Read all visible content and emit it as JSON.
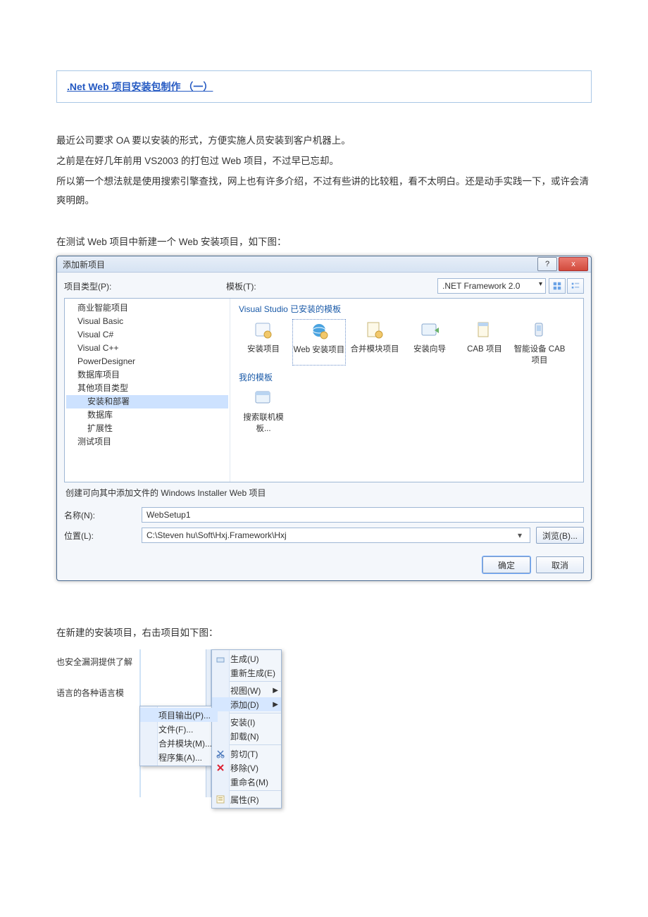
{
  "title_link": ".Net Web 项目安装包制作 （一）",
  "paragraphs": {
    "p1": "最近公司要求 OA 要以安装的形式，方便实施人员安装到客户机器上。",
    "p2": "之前是在好几年前用 VS2003 的打包过 Web 项目，不过早已忘却。",
    "p3": "所以第一个想法就是使用搜索引擎查找，网上也有许多介绍，不过有些讲的比较粗，看不太明白。还是动手实践一下，或许会清爽明朗。",
    "p4": "在测试 Web 项目中新建一个 Web 安装项目，如下图：",
    "p5": "在新建的安装项目，右击项目如下图："
  },
  "dialog": {
    "title": "添加新项目",
    "help": "?",
    "close": "x",
    "project_type_label": "项目类型(P):",
    "template_label": "模板(T):",
    "framework": ".NET Framework 2.0",
    "tree": [
      "商业智能项目",
      "Visual Basic",
      "Visual C#",
      "Visual C++",
      "PowerDesigner",
      "数据库项目",
      "其他项目类型",
      "安装和部署",
      "数据库",
      "扩展性",
      "测试项目"
    ],
    "tree_indents": [
      0,
      0,
      0,
      0,
      0,
      0,
      0,
      1,
      1,
      1,
      0
    ],
    "group_installed": "Visual Studio 已安装的模板",
    "group_my": "我的模板",
    "templates": [
      "安装项目",
      "Web 安装项目",
      "合并模块项目",
      "安装向导",
      "CAB 项目",
      "智能设备 CAB 项目"
    ],
    "search_online": "搜索联机模板...",
    "description": "创建可向其中添加文件的 Windows Installer Web 项目",
    "name_label": "名称(N):",
    "name_value": "WebSetup1",
    "location_label": "位置(L):",
    "location_value": "C:\\Steven hu\\Soft\\Hxj.Framework\\Hxj",
    "browse": "浏览(B)...",
    "ok": "确定",
    "cancel": "取消"
  },
  "ctx": {
    "left_rows": [
      "也安全漏洞提供了解",
      "语言的各种语言模"
    ],
    "left_menu": [
      "项目输出(P)...",
      "文件(F)...",
      "合并模块(M)...",
      "程序集(A)..."
    ],
    "right_menu": [
      {
        "label": "生成(U)",
        "icon": "build"
      },
      {
        "label": "重新生成(E)"
      },
      {
        "label": "视图(W)",
        "arrow": true
      },
      {
        "label": "添加(D)",
        "arrow": true,
        "sel": true
      },
      {
        "label": "安装(I)"
      },
      {
        "label": "卸载(N)"
      },
      {
        "label": "剪切(T)",
        "icon": "cut"
      },
      {
        "label": "移除(V)",
        "icon": "remove"
      },
      {
        "label": "重命名(M)"
      },
      {
        "label": "属性(R)",
        "icon": "props"
      }
    ]
  }
}
